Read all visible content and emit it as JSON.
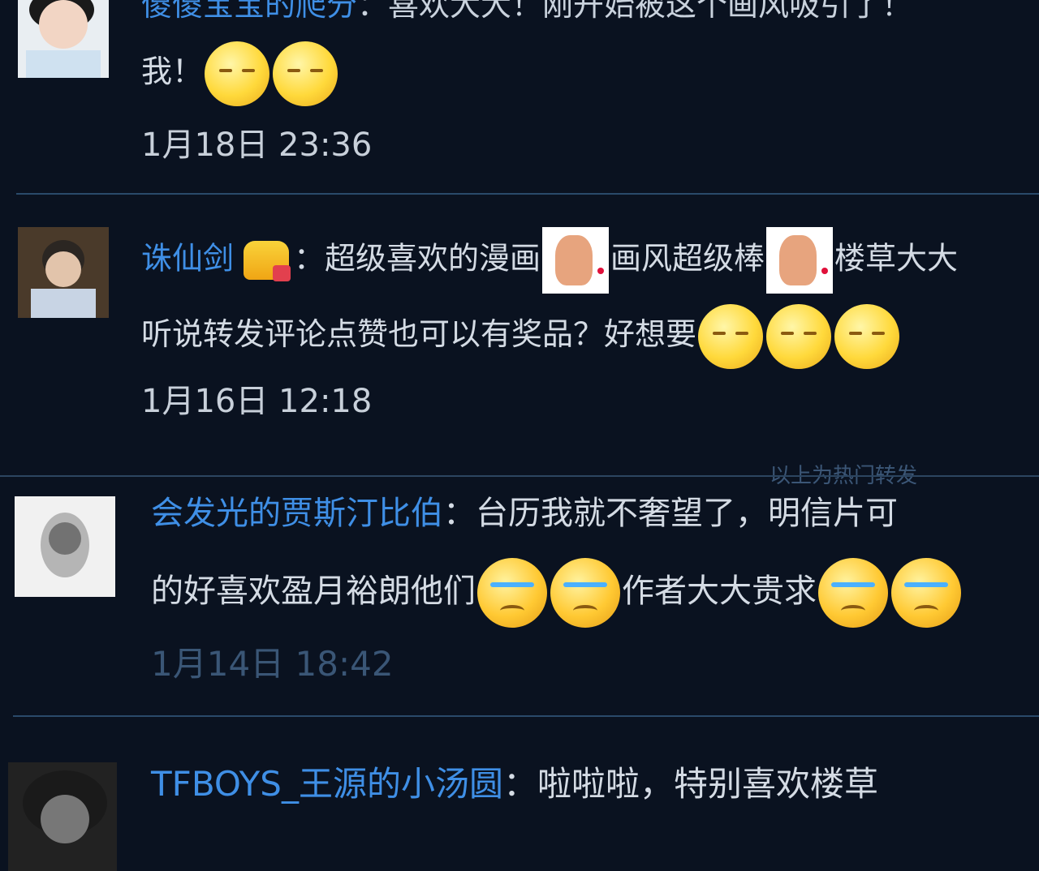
{
  "comments": [
    {
      "name": "傻傻宝宝的爬分",
      "text_line1": "：喜欢大大！刚开始被这个画风吸引了！",
      "text_line2": "我！",
      "time": "1月18日 23:36"
    },
    {
      "name": "诛仙剑",
      "text_line1_a": "：超级喜欢的漫画",
      "text_line1_b": "画风超级棒",
      "text_line1_c": "楼草大大",
      "text_line2": "听说转发评论点赞也可以有奖品？好想要",
      "time": "1月16日 12:18"
    },
    {
      "name": "会发光的贾斯汀比伯",
      "text_line1": "：台历我就不奢望了，明信片可",
      "text_line2_a": "的好喜欢盈月裕朗他们",
      "text_line2_b": "作者大大贵求",
      "time": "1月14日 18:42"
    },
    {
      "name": "TFBOYS_王源的小汤圆",
      "text_line1": "：啦啦啦，特别喜欢楼草"
    }
  ],
  "hot_label": "以上为热门转发",
  "emoticons": [
    "shy-face-icon",
    "sticker-icon",
    "crying-face-icon",
    "crown-icon"
  ]
}
